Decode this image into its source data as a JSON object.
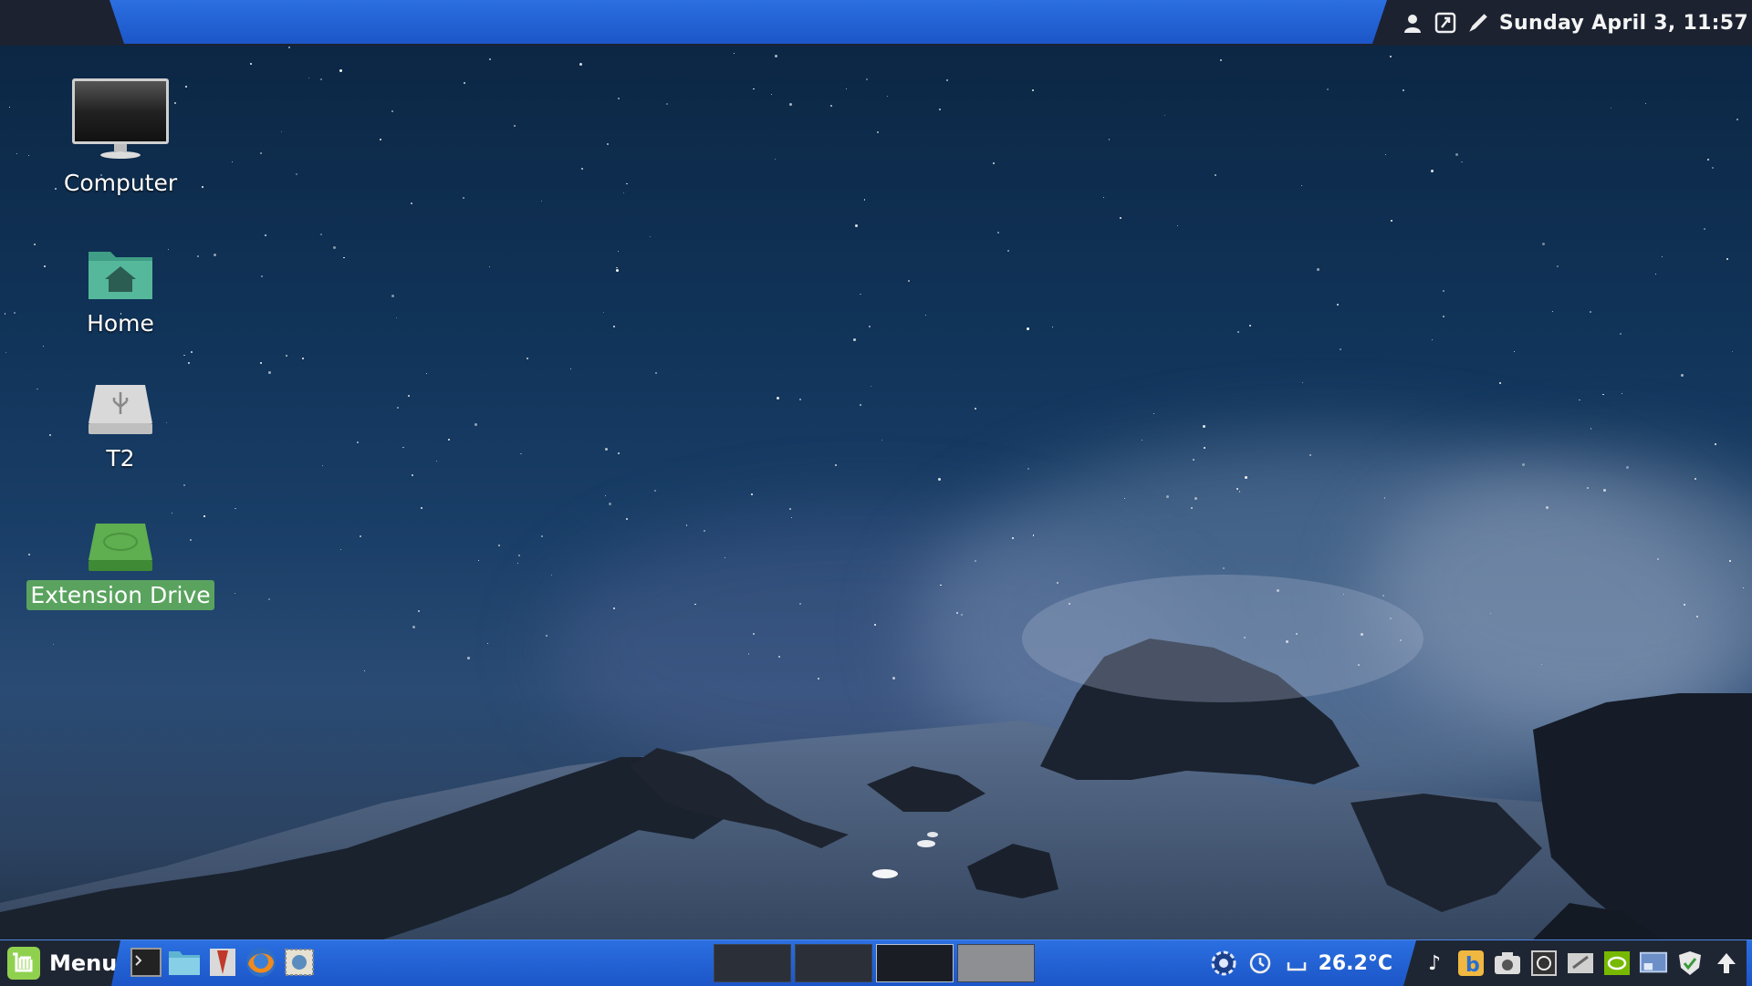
{
  "top_panel": {
    "clock": "Sunday April  3, 11:57",
    "icons": [
      "user-icon",
      "screenshot-icon",
      "pen-icon"
    ]
  },
  "desktop": {
    "items": [
      {
        "label": "Computer",
        "icon": "computer-icon",
        "selected": false
      },
      {
        "label": "Home",
        "icon": "home-folder-icon",
        "selected": false
      },
      {
        "label": "T2",
        "icon": "usb-drive-icon",
        "selected": false
      },
      {
        "label": "Extension Drive",
        "icon": "hard-drive-icon",
        "selected": true
      }
    ]
  },
  "bottom_panel": {
    "menu_label": "Menu",
    "launchers": [
      "terminal-icon",
      "files-icon",
      "text-editor-icon",
      "firefox-icon",
      "mail-icon"
    ],
    "workspaces": 4,
    "active_workspace": 3,
    "temperature": "26.2°C",
    "tray_icons": [
      "settings-gear-icon",
      "clock-icon",
      "keyboard-icon",
      "music-note-icon",
      "bluetooth-icon",
      "camera-icon",
      "system-monitor-icon",
      "network-tool-icon",
      "nvidia-icon",
      "display-icon",
      "shield-icon",
      "update-arrow-icon"
    ]
  },
  "colors": {
    "panel_blue": "#2b6fe0",
    "panel_dark": "#1f2633",
    "selection_green": "#5aa35f"
  }
}
